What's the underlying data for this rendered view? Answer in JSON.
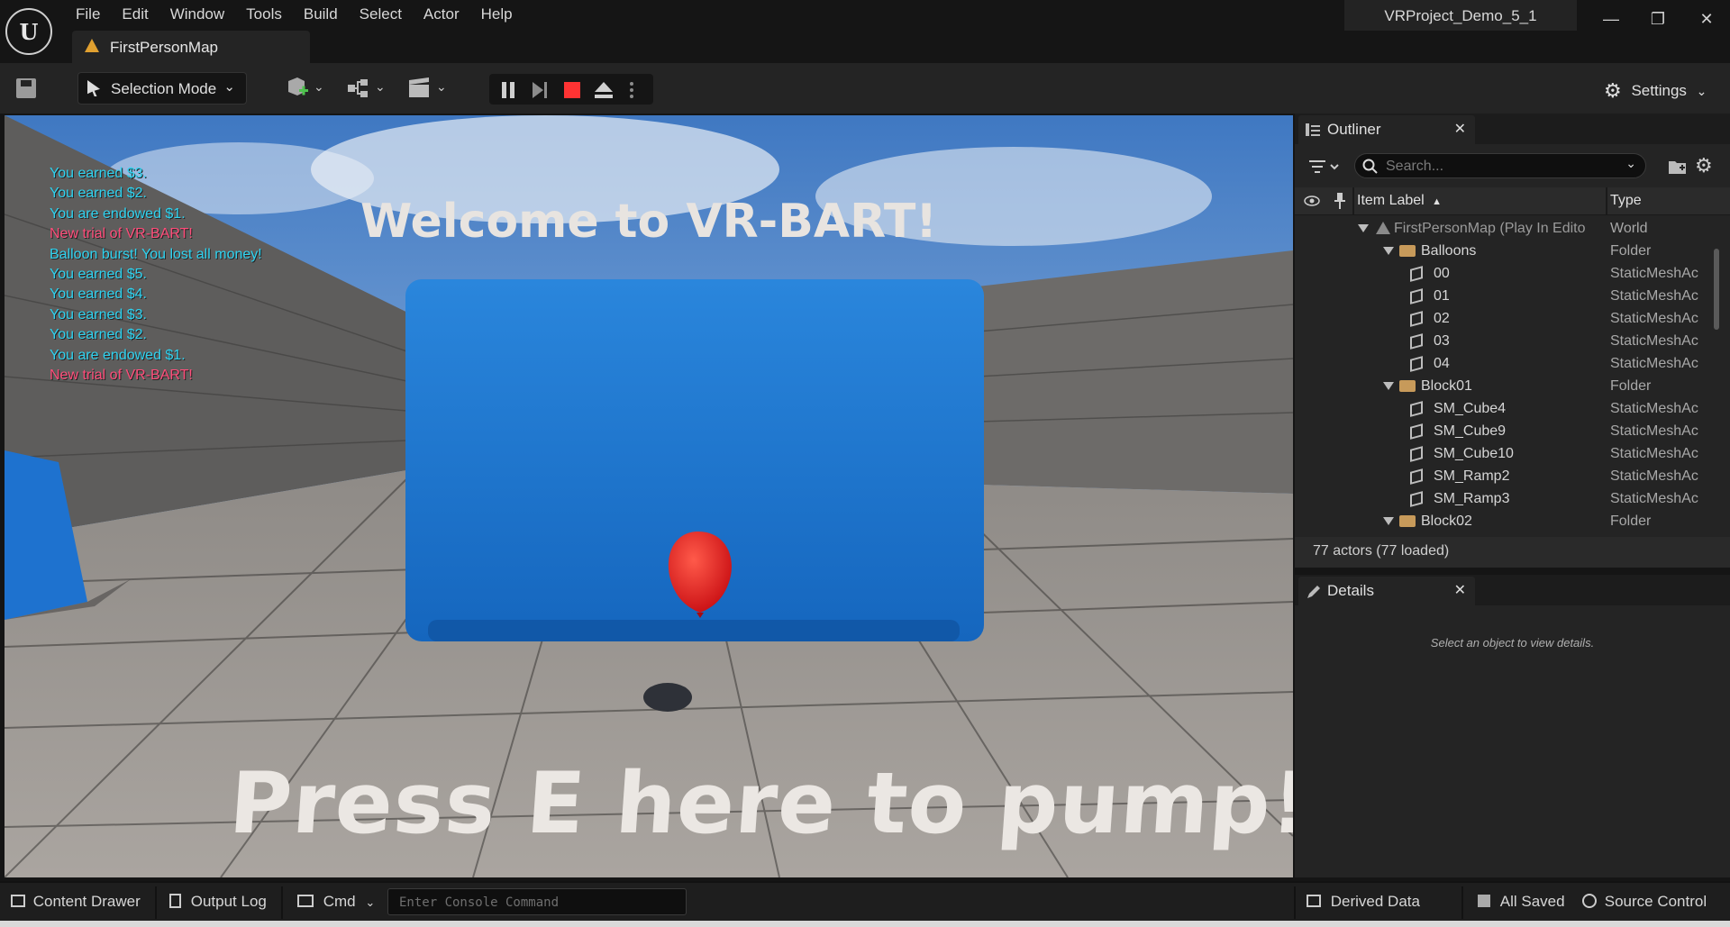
{
  "menu": [
    "File",
    "Edit",
    "Window",
    "Tools",
    "Build",
    "Select",
    "Actor",
    "Help"
  ],
  "map_tab": {
    "label": "FirstPersonMap"
  },
  "project_name": "VRProject_Demo_5_1",
  "toolbar": {
    "selection_mode": "Selection Mode",
    "settings_label": "Settings"
  },
  "viewport": {
    "log_lines": [
      {
        "text": "You earned $3.",
        "color": "#2fd3f0"
      },
      {
        "text": "You earned $2.",
        "color": "#2fd3f0"
      },
      {
        "text": "You are endowed  $1.",
        "color": "#2fd3f0"
      },
      {
        "text": "New trial of VR-BART!",
        "color": "#ff4d7a"
      },
      {
        "text": "Balloon burst! You lost all money!",
        "color": "#2fd3f0"
      },
      {
        "text": "You earned $5.",
        "color": "#2fd3f0"
      },
      {
        "text": "You earned $4.",
        "color": "#2fd3f0"
      },
      {
        "text": "You earned $3.",
        "color": "#2fd3f0"
      },
      {
        "text": "You earned $2.",
        "color": "#2fd3f0"
      },
      {
        "text": "You are endowed  $1.",
        "color": "#2fd3f0"
      },
      {
        "text": "New trial of VR-BART!",
        "color": "#ff4d7a"
      }
    ],
    "welcome_text": "Welcome to VR-BART!",
    "pump_text": "Press E here to pump!"
  },
  "outliner": {
    "title": "Outliner",
    "search_placeholder": "Search...",
    "col_label": "Item Label",
    "col_type": "Type",
    "rows": [
      {
        "label": "FirstPersonMap (Play In Edito",
        "type": "World",
        "kind": "world",
        "depth": 0
      },
      {
        "label": "Balloons",
        "type": "Folder",
        "kind": "folder",
        "depth": 1
      },
      {
        "label": "00",
        "type": "StaticMeshAc",
        "kind": "mesh",
        "depth": 2
      },
      {
        "label": "01",
        "type": "StaticMeshAc",
        "kind": "mesh",
        "depth": 2
      },
      {
        "label": "02",
        "type": "StaticMeshAc",
        "kind": "mesh",
        "depth": 2
      },
      {
        "label": "03",
        "type": "StaticMeshAc",
        "kind": "mesh",
        "depth": 2
      },
      {
        "label": "04",
        "type": "StaticMeshAc",
        "kind": "mesh",
        "depth": 2
      },
      {
        "label": "Block01",
        "type": "Folder",
        "kind": "folder",
        "depth": 1
      },
      {
        "label": "SM_Cube4",
        "type": "StaticMeshAc",
        "kind": "mesh",
        "depth": 2
      },
      {
        "label": "SM_Cube9",
        "type": "StaticMeshAc",
        "kind": "mesh",
        "depth": 2
      },
      {
        "label": "SM_Cube10",
        "type": "StaticMeshAc",
        "kind": "mesh",
        "depth": 2
      },
      {
        "label": "SM_Ramp2",
        "type": "StaticMeshAc",
        "kind": "mesh",
        "depth": 2
      },
      {
        "label": "SM_Ramp3",
        "type": "StaticMeshAc",
        "kind": "mesh",
        "depth": 2
      },
      {
        "label": "Block02",
        "type": "Folder",
        "kind": "folder",
        "depth": 1
      }
    ],
    "actor_count": "77 actors (77 loaded)"
  },
  "details": {
    "title": "Details",
    "empty_message": "Select an object to view details."
  },
  "statusbar": {
    "content_drawer": "Content Drawer",
    "output_log": "Output Log",
    "cmd": "Cmd",
    "console_placeholder": "Enter Console Command",
    "derived_data": "Derived Data",
    "all_saved": "All Saved",
    "source_control": "Source Control"
  }
}
